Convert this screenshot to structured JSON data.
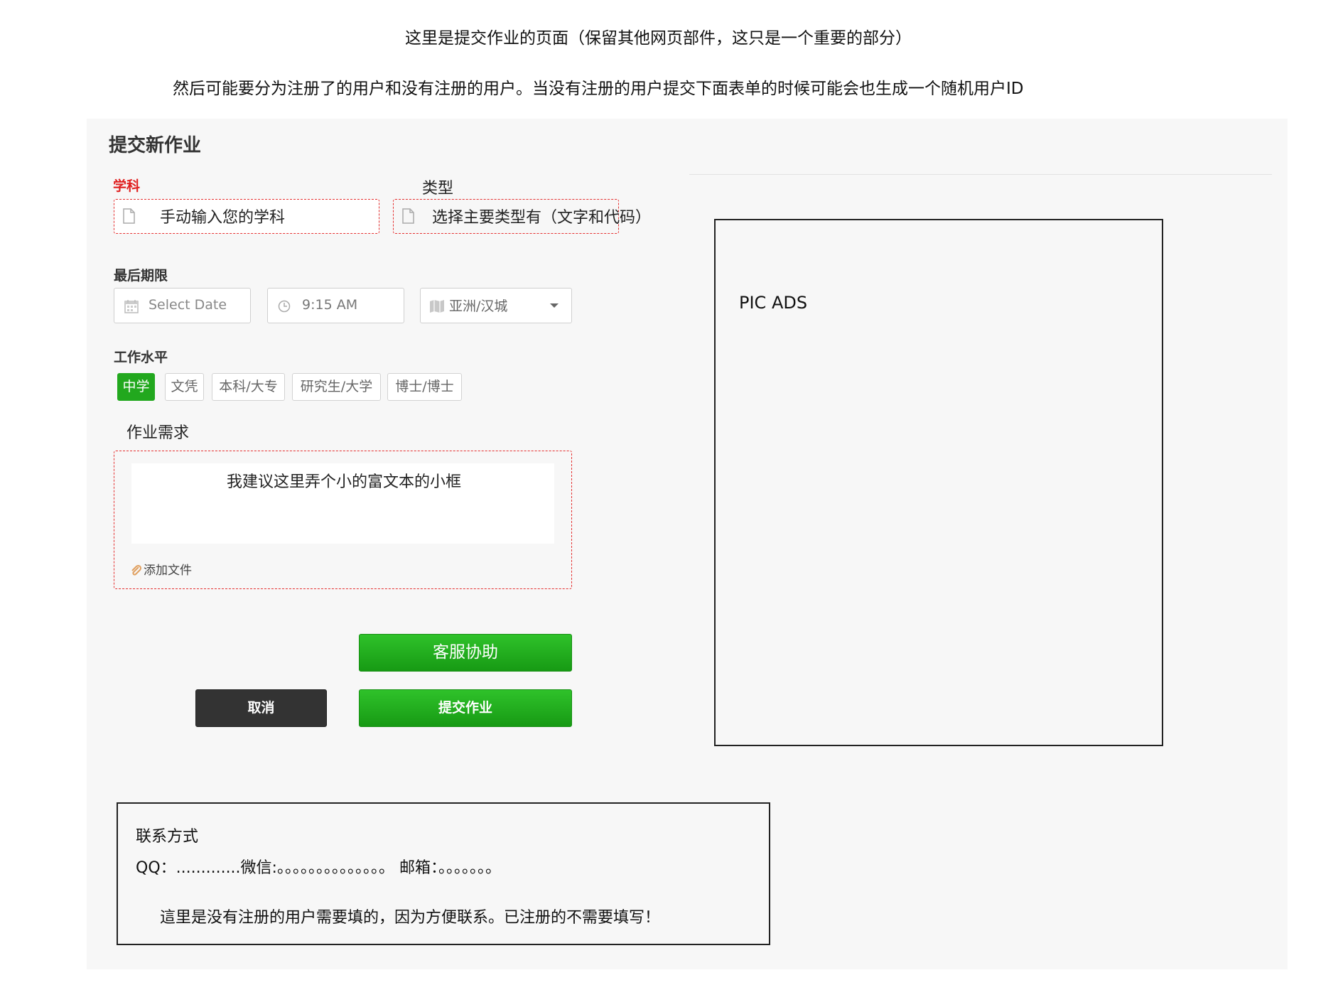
{
  "notes": {
    "line1": "这里是提交作业的页面（保留其他网页部件，这只是一个重要的部分）",
    "line2": "然后可能要分为注册了的用户和没有注册的用户。当没有注册的用户提交下面表单的时候可能会也生成一个随机用户ID"
  },
  "form": {
    "title": "提交新作业",
    "subject": {
      "label": "学科",
      "placeholder": "手动输入您的学科"
    },
    "type": {
      "label": "类型",
      "placeholder": "选择主要类型有（文字和代码）"
    },
    "deadline": {
      "label": "最后期限",
      "date_placeholder": "Select Date",
      "time_value": "9:15 AM",
      "timezone_value": "亚洲/汉城"
    },
    "level": {
      "label": "工作水平",
      "options": [
        "中学",
        "文凭",
        "本科/大专",
        "研究生/大学",
        "博士/博士"
      ],
      "selected": "中学"
    },
    "requirements": {
      "label": "作业需求",
      "editor_text": "我建议这里弄个小的富文本的小框",
      "attach_label": "添加文件"
    },
    "buttons": {
      "support": "客服协助",
      "cancel": "取消",
      "submit": "提交作业"
    }
  },
  "ad": {
    "text": "PIC ADS"
  },
  "contact": {
    "title": "联系方式",
    "fields_line": "QQ：.............微信:。。。。。。。。。。。。。。   邮箱：。。。。。。。",
    "note": "這里是没有注册的用户需要填的，因为方便联系。已注册的不需要填写！"
  },
  "colors": {
    "accent_green": "#22a81e",
    "dashed_red": "#e53030",
    "label_red": "#e02020"
  }
}
